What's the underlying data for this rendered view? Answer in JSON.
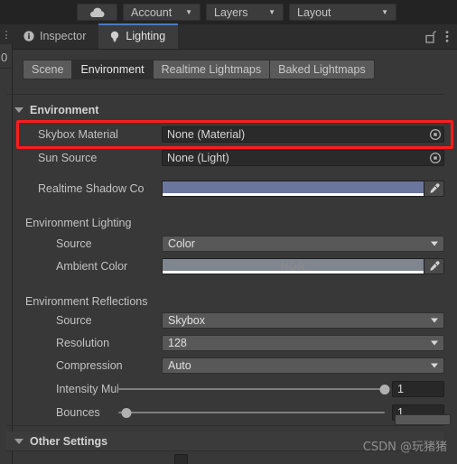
{
  "toolbar": {
    "cloud_icon": "cloud-icon",
    "account_label": "Account",
    "layers_label": "Layers",
    "layout_label": "Layout"
  },
  "left_strip": {
    "kebab_icon": "vertical-dots-icon",
    "clipped_value": "0"
  },
  "editor_tabs": {
    "items": [
      {
        "label": "Inspector",
        "icon": "info-icon",
        "active": false
      },
      {
        "label": "Lighting",
        "icon": "lightbulb-icon",
        "active": true
      }
    ],
    "lock_icon": "open-padlock-icon",
    "menu_icon": "vertical-dots-icon"
  },
  "sub_tabs": [
    {
      "label": "Scene",
      "active": false
    },
    {
      "label": "Environment",
      "active": true
    },
    {
      "label": "Realtime Lightmaps",
      "active": false
    },
    {
      "label": "Baked Lightmaps",
      "active": false
    }
  ],
  "sections": {
    "environment": {
      "title": "Environment",
      "skybox_material": {
        "label": "Skybox Material",
        "value": "None (Material)",
        "picker_icon": "object-picker-icon"
      },
      "sun_source": {
        "label": "Sun Source",
        "value": "None (Light)",
        "picker_icon": "object-picker-icon"
      },
      "realtime_shadow_color": {
        "label": "Realtime Shadow Co",
        "color": "#6a769d",
        "alpha_color": "#ffffff",
        "eyedropper_icon": "eyedropper-icon"
      },
      "environment_lighting": {
        "caption": "Environment Lighting",
        "source": {
          "label": "Source",
          "value": "Color"
        },
        "ambient_color": {
          "label": "Ambient Color",
          "color": "#808690",
          "badge": "HDR",
          "alpha_color": "#ffffff",
          "eyedropper_icon": "eyedropper-icon"
        }
      },
      "environment_reflections": {
        "caption": "Environment Reflections",
        "source": {
          "label": "Source",
          "value": "Skybox"
        },
        "resolution": {
          "label": "Resolution",
          "value": "128"
        },
        "compression": {
          "label": "Compression",
          "value": "Auto"
        },
        "intensity_multiplier": {
          "label": "Intensity Multiplier",
          "value": "1",
          "slider_percent": 100
        },
        "bounces": {
          "label": "Bounces",
          "value": "1",
          "slider_percent": 3
        }
      }
    },
    "other_settings": {
      "title": "Other Settings"
    }
  },
  "highlight": {
    "color": "#ff1c1c"
  },
  "watermark": {
    "text": "CSDN @玩猪猪"
  }
}
